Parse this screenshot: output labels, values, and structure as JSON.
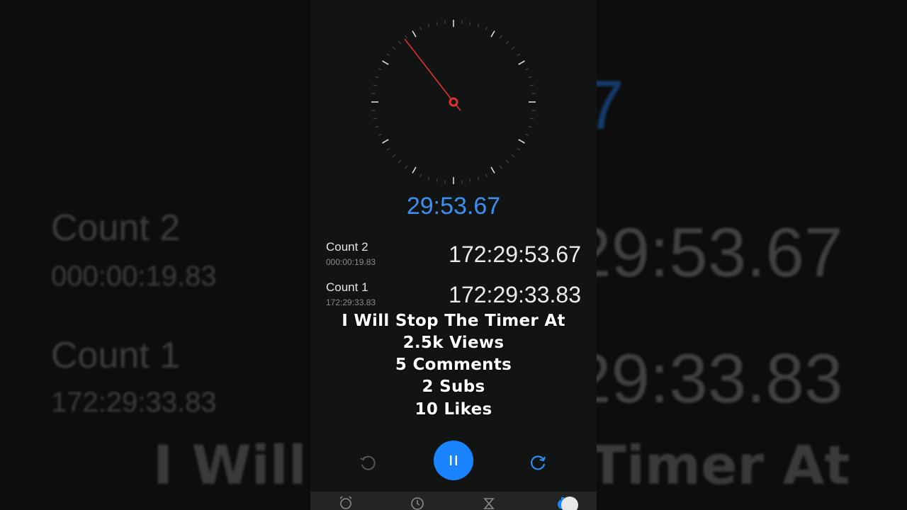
{
  "colors": {
    "accent": "#3d8ef0",
    "button": "#1a84ff",
    "hand": "#e03131",
    "panel": "#111412"
  },
  "stopwatch": {
    "elapsed": "29:53.67"
  },
  "laps": [
    {
      "name": "Count 2",
      "diff": "000:00:19.83",
      "total": "172:29:53.67"
    },
    {
      "name": "Count 1",
      "diff": "172:29:33.83",
      "total": "172:29:33.83"
    }
  ],
  "overlay": [
    "I Will Stop The Timer At",
    "2.5k Views",
    "5 Comments",
    "2 Subs",
    "10 Likes"
  ],
  "background": {
    "left": {
      "lap2_name": "Count 2",
      "lap2_diff": "000:00:19.83",
      "lap1_name": "Count 1",
      "lap1_diff": "172:29:33.83",
      "caption_fragment": "I Will"
    },
    "right": {
      "time_top": "29:53.67",
      "time_bottom": "29:33.83",
      "caption_fragment": "Timer At",
      "blue_fragment": "7"
    }
  },
  "controls": {
    "lap": "lap-icon",
    "pause": "pause-icon",
    "reset": "reset-icon"
  },
  "tabs": [
    "alarm-icon",
    "clock-icon",
    "timer-icon",
    "stopwatch-icon"
  ]
}
